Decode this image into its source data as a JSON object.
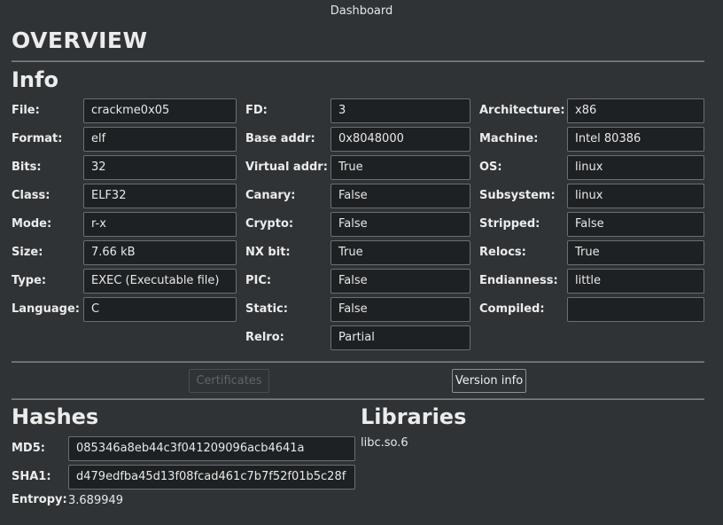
{
  "window": {
    "title": "Dashboard"
  },
  "overview": {
    "title": "OVERVIEW"
  },
  "info": {
    "title": "Info",
    "col1": [
      {
        "label": "File:",
        "value": "crackme0x05"
      },
      {
        "label": "Format:",
        "value": "elf"
      },
      {
        "label": "Bits:",
        "value": "32"
      },
      {
        "label": "Class:",
        "value": "ELF32"
      },
      {
        "label": "Mode:",
        "value": "r-x"
      },
      {
        "label": "Size:",
        "value": "7.66 kB"
      },
      {
        "label": "Type:",
        "value": "EXEC (Executable file)"
      },
      {
        "label": "Language:",
        "value": "C"
      }
    ],
    "col2": [
      {
        "label": "FD:",
        "value": "3"
      },
      {
        "label": "Base addr:",
        "value": "0x8048000"
      },
      {
        "label": "Virtual addr:",
        "value": "True"
      },
      {
        "label": "Canary:",
        "value": "False"
      },
      {
        "label": "Crypto:",
        "value": "False"
      },
      {
        "label": "NX bit:",
        "value": "True"
      },
      {
        "label": "PIC:",
        "value": "False"
      },
      {
        "label": "Static:",
        "value": "False"
      },
      {
        "label": "Relro:",
        "value": "Partial"
      }
    ],
    "col3": [
      {
        "label": "Architecture:",
        "value": "x86"
      },
      {
        "label": "Machine:",
        "value": "Intel 80386"
      },
      {
        "label": "OS:",
        "value": "linux"
      },
      {
        "label": "Subsystem:",
        "value": "linux"
      },
      {
        "label": "Stripped:",
        "value": "False"
      },
      {
        "label": "Relocs:",
        "value": "True"
      },
      {
        "label": "Endianness:",
        "value": "little"
      },
      {
        "label": "Compiled:",
        "value": ""
      }
    ]
  },
  "buttons": {
    "certificates": "Certificates",
    "version_info": "Version info"
  },
  "hashes": {
    "title": "Hashes",
    "md5_label": "MD5:",
    "md5": "085346a8eb44c3f041209096acb4641a",
    "sha1_label": "SHA1:",
    "sha1": "d479edfba45d13f08fcad461c7b7f52f01b5c28f",
    "entropy_label": "Entropy:",
    "entropy": "3.689949"
  },
  "libraries": {
    "title": "Libraries",
    "items": [
      "libc.so.6"
    ]
  }
}
